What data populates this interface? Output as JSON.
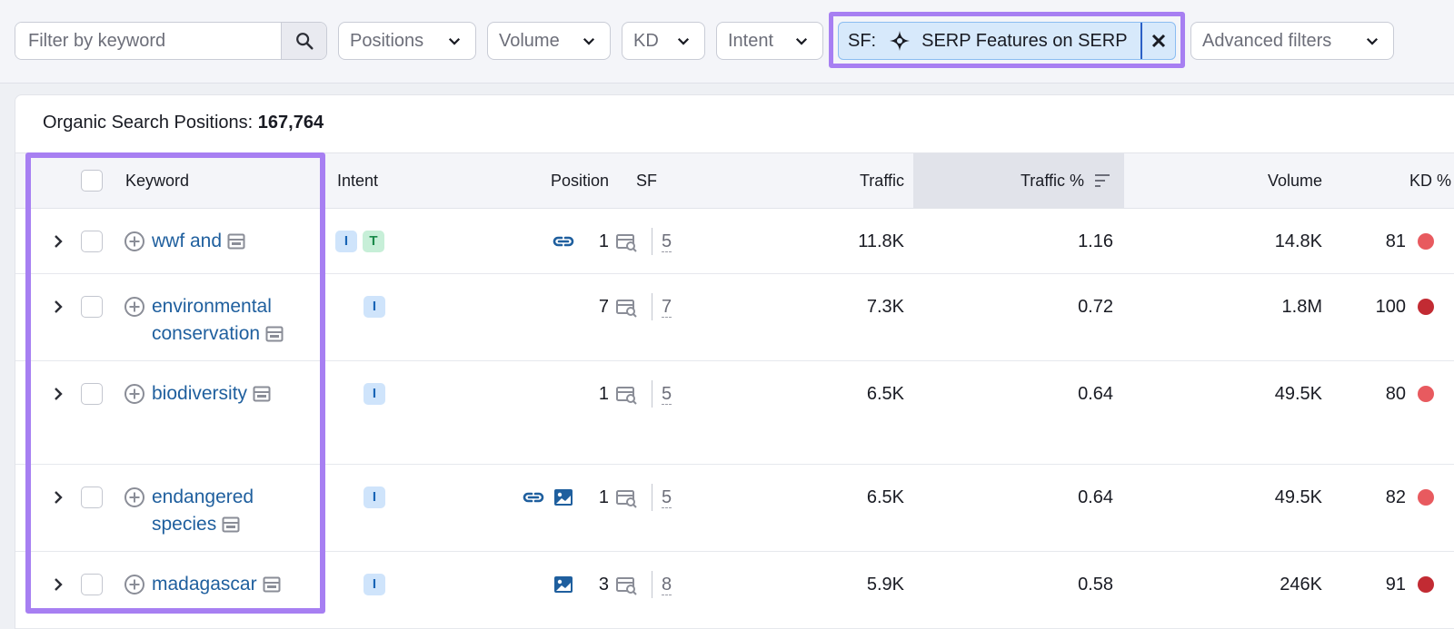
{
  "filters": {
    "search_placeholder": "Filter by keyword",
    "positions_label": "Positions",
    "volume_label": "Volume",
    "kd_label": "KD",
    "intent_label": "Intent",
    "sf_chip": {
      "prefix": "SF:",
      "text": "SERP Features on SERP"
    },
    "advanced_label": "Advanced filters"
  },
  "summary": {
    "label": "Organic Search Positions:",
    "count": "167,764"
  },
  "table": {
    "columns": [
      "Keyword",
      "Intent",
      "Position",
      "SF",
      "Traffic",
      "Traffic %",
      "Volume",
      "KD %"
    ],
    "sorted_column": "Traffic %",
    "rows": [
      {
        "keyword_lines": [
          "wwf and",
          ""
        ],
        "intents": [
          "I",
          "T"
        ],
        "position_icons": [
          "link-icon"
        ],
        "position": "1",
        "sf_count": "5",
        "traffic": "11.8K",
        "traffic_pct": "1.16",
        "volume": "14.8K",
        "kd": "81",
        "kd_color": "#e85a5f"
      },
      {
        "keyword_lines": [
          "environmental",
          "conservation"
        ],
        "intents": [
          "I"
        ],
        "position_icons": [],
        "position": "7",
        "sf_count": "7",
        "traffic": "7.3K",
        "traffic_pct": "0.72",
        "volume": "1.8M",
        "kd": "100",
        "kd_color": "#c22b33"
      },
      {
        "keyword_lines": [
          "biodiversity",
          ""
        ],
        "intents": [
          "I"
        ],
        "position_icons": [],
        "position": "1",
        "sf_count": "5",
        "traffic": "6.5K",
        "traffic_pct": "0.64",
        "volume": "49.5K",
        "kd": "80",
        "kd_color": "#e85a5f"
      },
      {
        "keyword_lines": [
          "endangered",
          "species"
        ],
        "intents": [
          "I"
        ],
        "position_icons": [
          "link-icon",
          "image-icon"
        ],
        "position": "1",
        "sf_count": "5",
        "traffic": "6.5K",
        "traffic_pct": "0.64",
        "volume": "49.5K",
        "kd": "82",
        "kd_color": "#e85a5f"
      },
      {
        "keyword_lines": [
          "madagascar",
          ""
        ],
        "intents": [
          "I"
        ],
        "position_icons": [
          "image-icon"
        ],
        "position": "3",
        "sf_count": "8",
        "traffic": "5.9K",
        "traffic_pct": "0.58",
        "volume": "246K",
        "kd": "91",
        "kd_color": "#c22b33"
      }
    ]
  },
  "colors": {
    "highlight": "#a77ff2",
    "link": "#1f5f9e",
    "chip_bg": "#d7e9fb"
  }
}
